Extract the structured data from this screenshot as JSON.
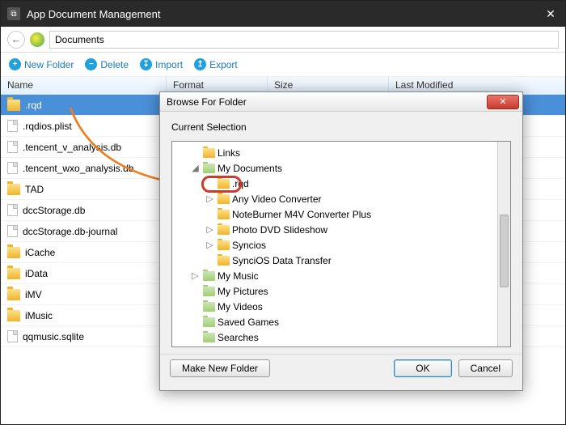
{
  "window": {
    "title": "App Document Management"
  },
  "path": {
    "value": "Documents"
  },
  "toolbar": {
    "new_folder": "New Folder",
    "delete": "Delete",
    "import": "Import",
    "export": "Export"
  },
  "columns": {
    "name": "Name",
    "format": "Format",
    "size": "Size",
    "modified": "Last Modified"
  },
  "files": [
    {
      "name": ".rqd",
      "type": "folder",
      "selected": true
    },
    {
      "name": ".rqdios.plist",
      "type": "file"
    },
    {
      "name": ".tencent_v_analysis.db",
      "type": "file"
    },
    {
      "name": ".tencent_wxo_analysis.db",
      "type": "file"
    },
    {
      "name": "TAD",
      "type": "folder"
    },
    {
      "name": "dccStorage.db",
      "type": "file"
    },
    {
      "name": "dccStorage.db-journal",
      "type": "file"
    },
    {
      "name": "iCache",
      "type": "folder"
    },
    {
      "name": "iData",
      "type": "folder"
    },
    {
      "name": "iMV",
      "type": "folder"
    },
    {
      "name": "iMusic",
      "type": "folder"
    },
    {
      "name": "qqmusic.sqlite",
      "type": "file"
    }
  ],
  "dialog": {
    "title": "Browse For Folder",
    "label": "Current Selection",
    "make_new": "Make New Folder",
    "ok": "OK",
    "cancel": "Cancel",
    "tree": [
      {
        "depth": 1,
        "expander": "",
        "name": "Links",
        "special": false
      },
      {
        "depth": 1,
        "expander": "◢",
        "name": "My Documents",
        "special": true
      },
      {
        "depth": 2,
        "expander": "",
        "name": ".rqd",
        "special": false,
        "highlighted": true
      },
      {
        "depth": 2,
        "expander": "▷",
        "name": "Any Video Converter",
        "special": false
      },
      {
        "depth": 2,
        "expander": "",
        "name": "NoteBurner M4V Converter Plus",
        "special": false
      },
      {
        "depth": 2,
        "expander": "▷",
        "name": "Photo DVD Slideshow",
        "special": false
      },
      {
        "depth": 2,
        "expander": "▷",
        "name": "Syncios",
        "special": false
      },
      {
        "depth": 2,
        "expander": "",
        "name": "SynciOS Data Transfer",
        "special": false
      },
      {
        "depth": 1,
        "expander": "▷",
        "name": "My Music",
        "special": true
      },
      {
        "depth": 1,
        "expander": "",
        "name": "My Pictures",
        "special": true
      },
      {
        "depth": 1,
        "expander": "",
        "name": "My Videos",
        "special": true
      },
      {
        "depth": 1,
        "expander": "",
        "name": "Saved Games",
        "special": true
      },
      {
        "depth": 1,
        "expander": "",
        "name": "Searches",
        "special": true
      }
    ]
  }
}
